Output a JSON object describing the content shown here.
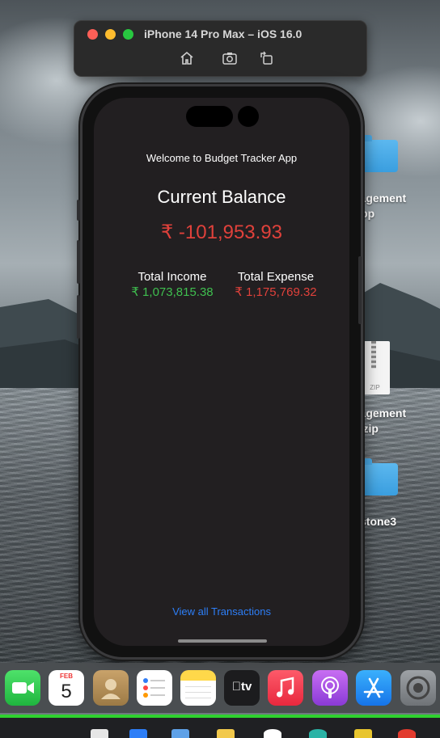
{
  "simulator": {
    "title": "iPhone 14 Pro Max – iOS 16.0",
    "tools": [
      "home-icon",
      "screenshot-icon",
      "rotate-icon"
    ]
  },
  "desktop": {
    "items": [
      {
        "label_line1": "nagement",
        "label_line2": "App",
        "icon": "folder-icon"
      },
      {
        "label_line1": "nagement",
        "label_line2": "p.zip",
        "icon": "zip-file-icon",
        "file_text": "ZIP"
      },
      {
        "label_line1": "stone3",
        "icon": "folder-icon"
      }
    ]
  },
  "app": {
    "welcome": "Welcome to Budget Tracker App",
    "balance_title": "Current Balance",
    "balance_amount": "₹ -101,953.93",
    "income_label": "Total Income",
    "income_value": "₹ 1,073,815.38",
    "expense_label": "Total Expense",
    "expense_value": "₹ 1,175,769.32",
    "view_all": "View all Transactions"
  },
  "dock": {
    "calendar_month": "FEB",
    "calendar_day": "5",
    "tv_label": "tv",
    "apps": [
      "facetime-icon",
      "calendar-icon",
      "contacts-icon",
      "reminders-icon",
      "notes-icon",
      "apple-tv-icon",
      "music-icon",
      "podcasts-icon",
      "app-store-icon",
      "system-settings-icon"
    ]
  },
  "colors": {
    "accent_link": "#2d7ef7",
    "negative": "#e0413b",
    "positive": "#3fbf4f",
    "screen_bg": "#221f21"
  }
}
